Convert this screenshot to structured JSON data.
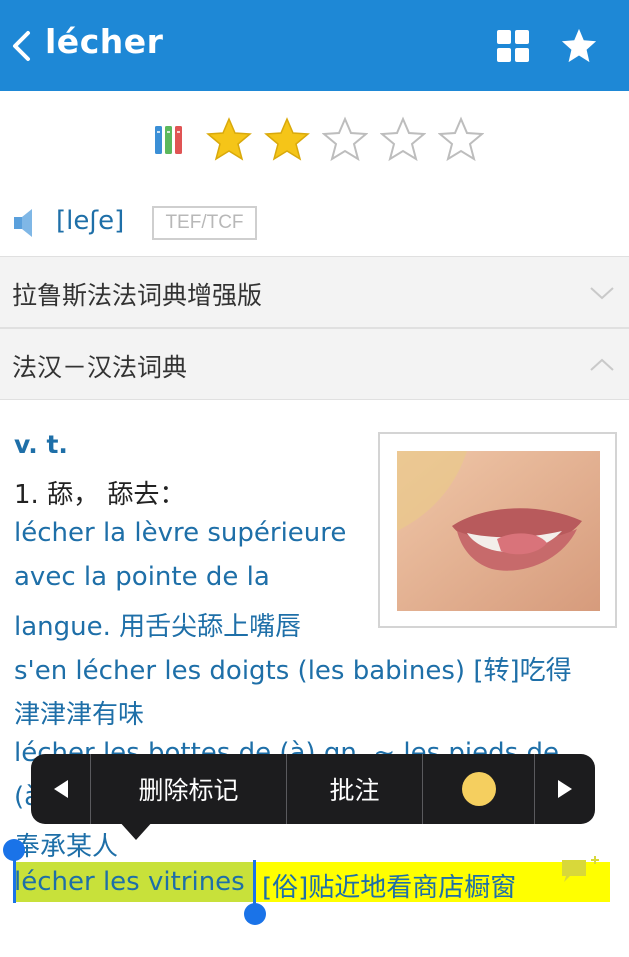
{
  "header": {
    "title": "lécher",
    "back_icon": "chevron-left-icon",
    "grid_icon": "grid-icon",
    "favorite_icon": "star-icon"
  },
  "rating": {
    "frequency_icon": "books-icon",
    "stars_filled": 2,
    "stars_total": 5,
    "star_color": "#f5c518"
  },
  "pronunciation": {
    "phonetic": "[leʃe]",
    "exam_tag": "TEF/TCF",
    "speaker_icon": "speaker-icon"
  },
  "dictionaries": [
    {
      "name": "拉鲁斯法法词典增强版",
      "expanded": false
    },
    {
      "name": "法汉－汉法词典",
      "expanded": true
    }
  ],
  "entry": {
    "pos": "v. t.",
    "sense1": "1. 舔， 舔去：",
    "ex1_line1": "lécher la lèvre supérieure",
    "ex1_line2": "avec la pointe de la",
    "ex1_line3": "langue. 用舌尖舔上嘴唇",
    "ex2_line1": "s'en lécher les doigts (les babines) [转]吃得",
    "ex2_line2": "津津津有味",
    "ex3_line1": "lécher les bottes de (à) qn. ~ les pieds de",
    "ex3_line2": "(à",
    "ex3_line3": "奉承某人",
    "ex4_fr": "lécher les vitrines",
    "ex4_cn": "[俗]贴近地看商店橱窗"
  },
  "popup": {
    "prev_icon": "triangle-left-icon",
    "delete_label": "删除标记",
    "note_label": "批注",
    "color": "#f5cf5f",
    "next_icon": "triangle-right-icon"
  },
  "colors": {
    "primary": "#1e88d6",
    "link": "#1e6fa8",
    "highlight": "#ffff00",
    "selection": "#c8e13a"
  }
}
